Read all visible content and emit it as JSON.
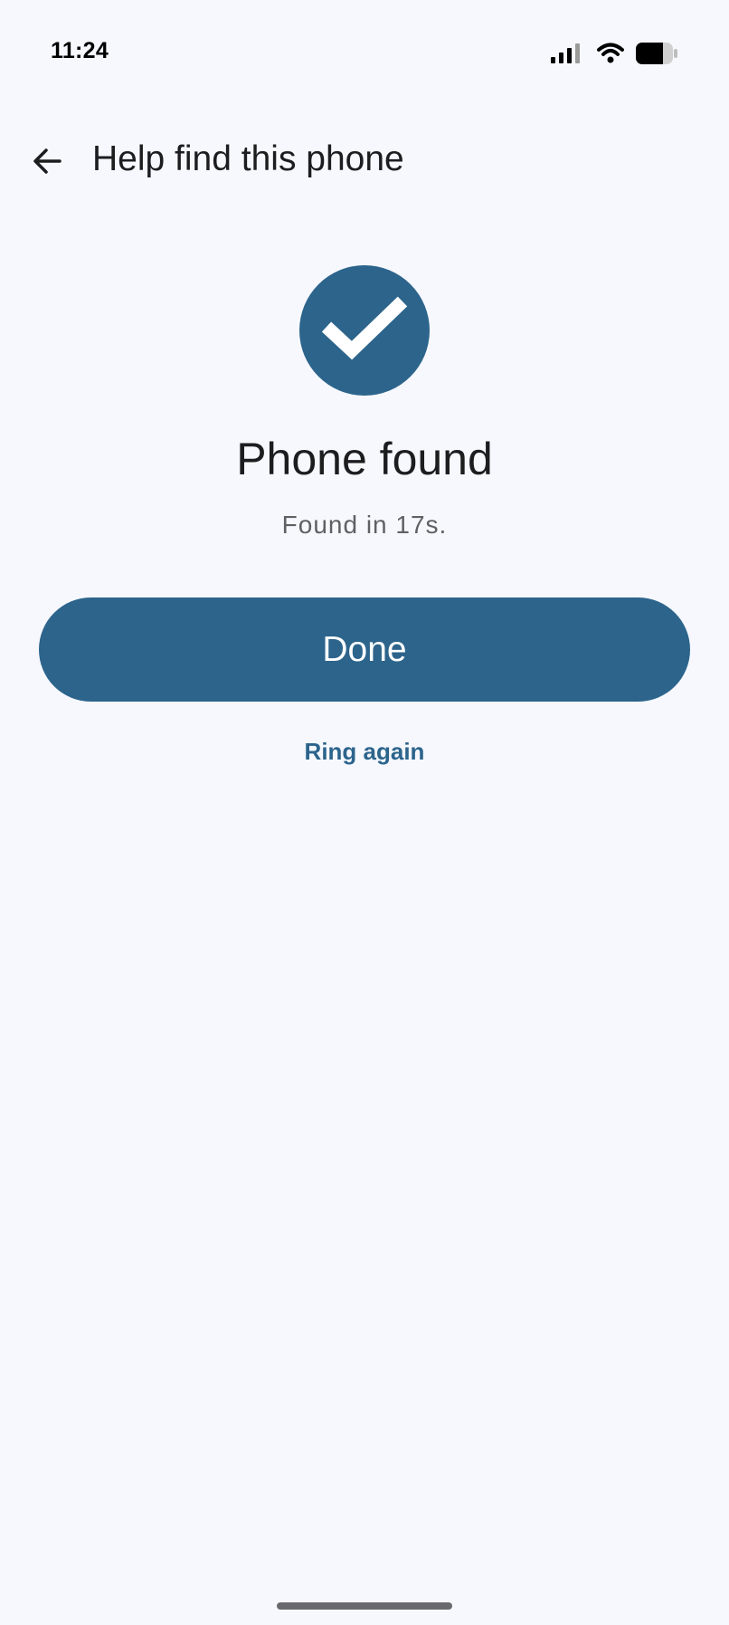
{
  "status_bar": {
    "time": "11:24",
    "icons": [
      "signal-icon",
      "wifi-icon",
      "battery-icon"
    ]
  },
  "app_bar": {
    "back_icon": "arrow-back-icon",
    "title": "Help find this phone"
  },
  "result": {
    "icon": "check-icon",
    "headline": "Phone found",
    "subtext": "Found in 17s."
  },
  "actions": {
    "done_label": "Done",
    "ring_again_label": "Ring again"
  },
  "colors": {
    "accent": "#2c648c",
    "background": "#f6f8fd",
    "text_primary": "#1d1d20",
    "text_secondary": "#5f6063"
  }
}
